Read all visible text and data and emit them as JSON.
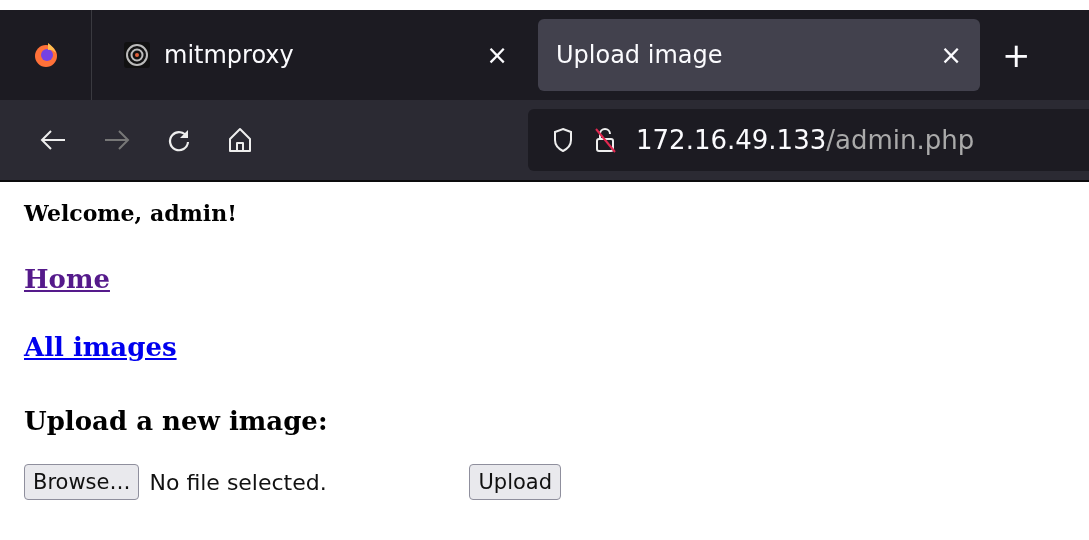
{
  "tabs": [
    {
      "title": "mitmproxy",
      "selected": false,
      "close": "×"
    },
    {
      "title": "Upload image",
      "selected": true,
      "close": "×"
    }
  ],
  "new_tab": "+",
  "address_bar": {
    "host": "172.16.49.133",
    "path": "/admin.php"
  },
  "page": {
    "welcome": "Welcome, admin!",
    "links": [
      {
        "label": "Home",
        "visited": true
      },
      {
        "label": "All images",
        "visited": false
      }
    ],
    "upload_heading": "Upload a new image:",
    "file_input": {
      "button": "Browse…",
      "status": "No file selected."
    },
    "submit": "Upload"
  }
}
